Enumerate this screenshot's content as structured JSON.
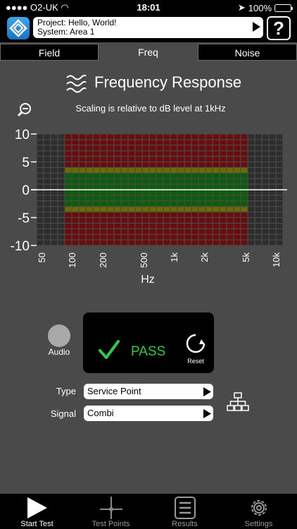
{
  "status": {
    "carrier": "O2-UK",
    "time": "18:01",
    "battery": "100%"
  },
  "header": {
    "project_line": "Project: Hello, World!",
    "system_line": "System: Area 1",
    "help_label": "?"
  },
  "tabs": [
    {
      "label": "Field"
    },
    {
      "label": "Freq"
    },
    {
      "label": "Noise"
    }
  ],
  "active_tab": "Freq",
  "page": {
    "title": "Frequency Response",
    "subtitle": "Scaling is relative to dB level at 1kHz"
  },
  "chart_data": {
    "type": "bar",
    "ylim": [
      -10,
      10
    ],
    "y_ticks": [
      "10",
      "5",
      "0",
      "-5",
      "-10"
    ],
    "x_ticks": [
      "50",
      "100",
      "200",
      "500",
      "1k",
      "2k",
      "5k",
      "10k"
    ],
    "xlabel": "Hz",
    "tolerance_band": {
      "x_from": "100",
      "x_to": "5k",
      "green": [
        -3,
        3
      ],
      "amber": [
        -4,
        4
      ]
    },
    "measured_line": 0,
    "colors": {
      "green": "#0b5c0b",
      "amber": "#6b6b00",
      "red": "#6a0c0c",
      "inactive": "#2d2d2d",
      "grid": "#000000"
    }
  },
  "controls": {
    "audio_label": "Audio",
    "result": "PASS",
    "reset_label": "Reset",
    "type_label": "Type",
    "type_value": "Service Point",
    "signal_label": "Signal",
    "signal_value": "Combi"
  },
  "tabbar": [
    {
      "label": "Start Test",
      "icon": "play-icon"
    },
    {
      "label": "Test Points",
      "icon": "crosshair-icon"
    },
    {
      "label": "Results",
      "icon": "list-icon"
    },
    {
      "label": "Settings",
      "icon": "gear-icon"
    }
  ],
  "colors": {
    "pass": "#2ecc40",
    "accent": "#1c72c6"
  }
}
